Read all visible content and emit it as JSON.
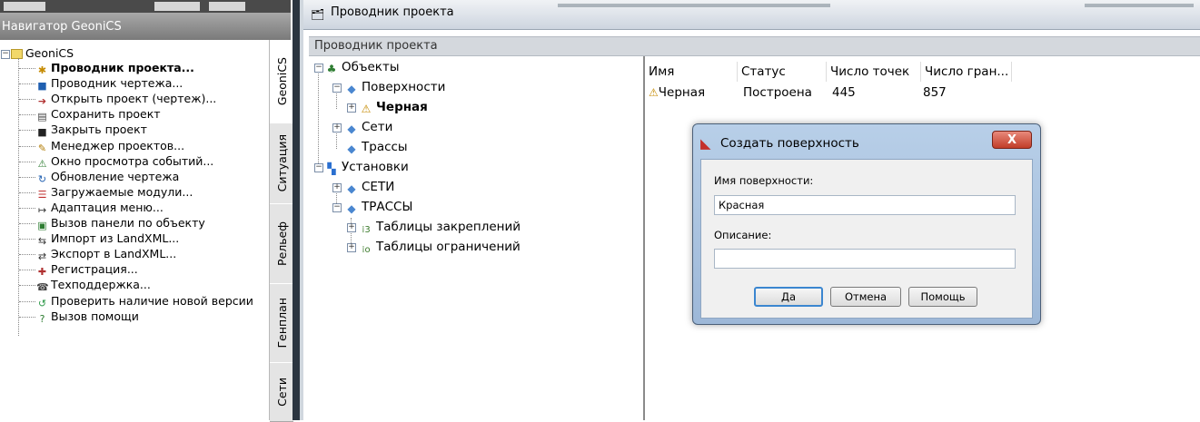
{
  "navigator": {
    "title": "Навигатор GeoniCS",
    "root": "GeoniCS",
    "items": [
      {
        "label": "Проводник проекта...",
        "icon": "project-explorer-icon",
        "bold": true
      },
      {
        "label": "Проводник чертежа...",
        "icon": "drawing-explorer-icon"
      },
      {
        "label": "Открыть проект (чертеж)...",
        "icon": "open-project-icon"
      },
      {
        "label": "Сохранить проект",
        "icon": "save-project-icon"
      },
      {
        "label": "Закрыть проект",
        "icon": "close-project-icon"
      },
      {
        "label": "Менеджер проектов...",
        "icon": "project-manager-icon"
      },
      {
        "label": "Окно просмотра событий...",
        "icon": "event-viewer-icon"
      },
      {
        "label": "Обновление чертежа",
        "icon": "refresh-drawing-icon"
      },
      {
        "label": "Загружаемые модули...",
        "icon": "modules-icon"
      },
      {
        "label": "Адаптация меню...",
        "icon": "menu-adapt-icon"
      },
      {
        "label": "Вызов панели по объекту",
        "icon": "object-panel-icon"
      },
      {
        "label": "Импорт из LandXML...",
        "icon": "import-landxml-icon"
      },
      {
        "label": "Экспорт в LandXML...",
        "icon": "export-landxml-icon"
      },
      {
        "label": "Регистрация...",
        "icon": "registration-icon"
      },
      {
        "label": "Техподдержка...",
        "icon": "support-icon"
      },
      {
        "label": "Проверить наличие новой версии",
        "icon": "update-check-icon"
      },
      {
        "label": "Вызов помощи",
        "icon": "help-icon"
      }
    ],
    "tabs": [
      "GeoniCS",
      "Ситуация",
      "Рельеф",
      "Генплан",
      "Сети"
    ]
  },
  "explorer": {
    "window_title": "Проводник проекта",
    "header": "Проводник проекта",
    "tree": {
      "objects": "Объекты",
      "surfaces": "Поверхности",
      "surface_black": "Черная",
      "networks": "Сети",
      "routes": "Трассы",
      "settings": "Установки",
      "set_networks": "СЕТИ",
      "set_routes": "ТРАССЫ",
      "anchors_table": "Таблицы закреплений",
      "limits_table": "Таблицы ограничений"
    },
    "columns": [
      "Имя",
      "Статус",
      "Число точек",
      "Число гран..."
    ],
    "rows": [
      {
        "name": "Черная",
        "status": "Построена",
        "points": "445",
        "faces": "857"
      }
    ]
  },
  "dialog": {
    "title": "Создать поверхность",
    "close": "X",
    "name_label": "Имя поверхности:",
    "name_value": "Красная",
    "desc_label": "Описание:",
    "desc_value": "",
    "ok": "Да",
    "cancel": "Отмена",
    "help": "Помощь"
  },
  "colors": {
    "tree_icon_blue": "#4a87d0",
    "dialog_frame": "#a9c2df",
    "close_red": "#c13d29"
  }
}
